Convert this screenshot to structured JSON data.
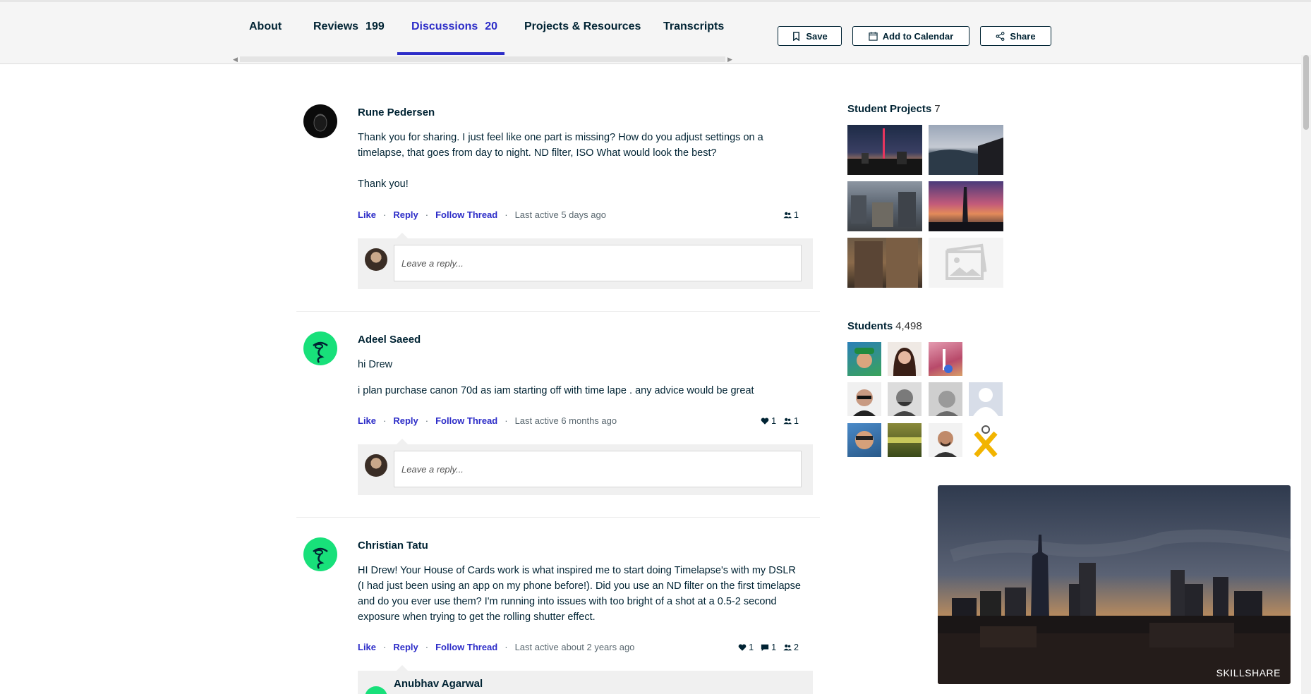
{
  "tabs": [
    {
      "label": "About",
      "count": ""
    },
    {
      "label": "Reviews",
      "count": "199"
    },
    {
      "label": "Discussions",
      "count": "20"
    },
    {
      "label": "Projects & Resources",
      "count": ""
    },
    {
      "label": "Transcripts",
      "count": ""
    }
  ],
  "actions": {
    "save": "Save",
    "calendar": "Add to Calendar",
    "share": "Share"
  },
  "comment_actions": {
    "like": "Like",
    "reply": "Reply",
    "follow": "Follow Thread"
  },
  "reply_placeholder": "Leave a reply...",
  "comments": [
    {
      "author": "Rune Pedersen",
      "paragraphs": [
        "Thank you for sharing. I just feel like one part is missing? How do you adjust settings on a timelapse, that goes from day to night. ND filter, ISO What would look the best?",
        "Thank you!"
      ],
      "last_active": "Last active 5 days ago",
      "stats": {
        "likes": "",
        "replies": "",
        "followers": "1"
      }
    },
    {
      "author": "Adeel Saeed",
      "paragraphs": [
        "hi Drew",
        "i plan purchase canon 70d as iam starting off with time lape . any advice would be great"
      ],
      "last_active": "Last active 6 months ago",
      "stats": {
        "likes": "1",
        "replies": "",
        "followers": "1"
      }
    },
    {
      "author": "Christian Tatu",
      "paragraphs": [
        "HI Drew! Your House of Cards work is what inspired me to start doing Timelapse's with my DSLR (I had just been using an app on my phone before!). Did you use an ND filter on the first timelapse and do you ever use them? I'm running into issues with too bright of a shot at a 0.5-2 second exposure when trying to get the rolling shutter effect."
      ],
      "last_active": "Last active about 2 years ago",
      "stats": {
        "likes": "1",
        "replies": "1",
        "followers": "2"
      }
    }
  ],
  "nested_reply": {
    "author": "Anubhav Agarwal"
  },
  "sidebar": {
    "projects_title": "Student Projects",
    "projects_count": "7",
    "students_title": "Students",
    "students_count": "4,498"
  },
  "video": {
    "brand": "SKILLSHARE"
  },
  "icons": [
    "bookmark-icon",
    "calendar-icon",
    "share-icon",
    "heart-icon",
    "comment-icon",
    "people-icon",
    "image-placeholder-icon",
    "chevron-left-icon",
    "chevron-right-icon"
  ],
  "colors": {
    "accent": "#2d2dc8",
    "text": "#002333",
    "avatar_green": "#18e07a"
  }
}
